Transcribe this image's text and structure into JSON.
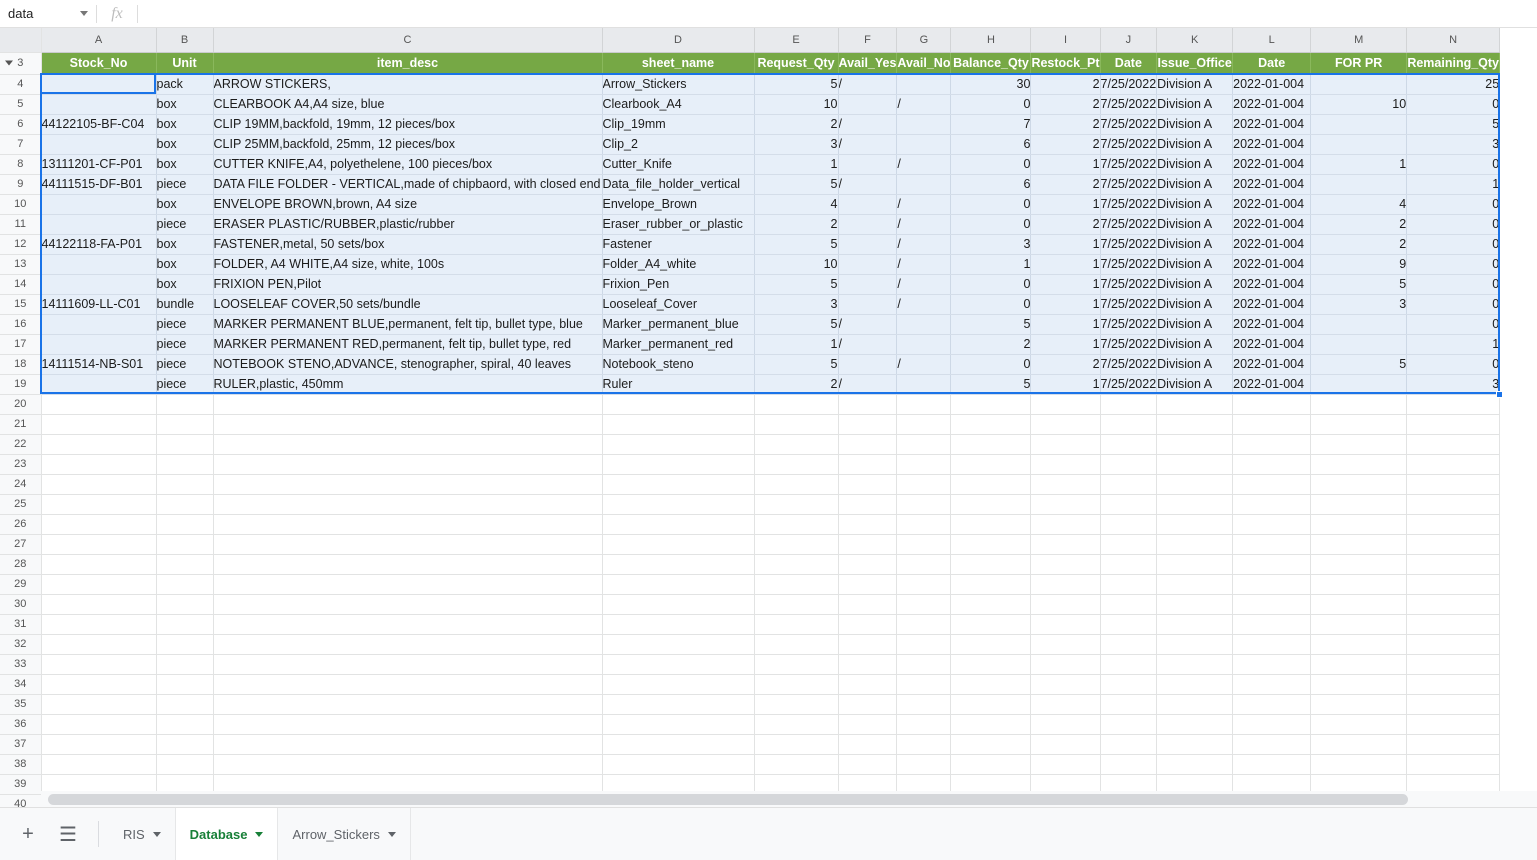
{
  "formula_bar": {
    "name_box_value": "data",
    "name_box_caret_icon": "chevron-down-icon",
    "fx_icon": "fx-icon",
    "formula_value": "",
    "formula_placeholder": ""
  },
  "grid": {
    "column_letters": [
      "A",
      "B",
      "C",
      "D",
      "E",
      "F",
      "G",
      "H",
      "I",
      "J",
      "K",
      "L",
      "M",
      "N"
    ],
    "header_row_number": "3",
    "headers": [
      "Stock_No",
      "Unit",
      "item_desc",
      "sheet_name",
      "Request_Qty",
      "Avail_Yes",
      "Avail_No",
      "Balance_Qty",
      "Restock_Pt",
      "Date",
      "Issue_Office",
      "Date",
      "FOR PR",
      "Remaining_Qty"
    ],
    "header_fill_color": "#76a845",
    "header_text_color": "#ffffff",
    "row_band_color": "#e7eff9",
    "selection_color": "#1a73e8",
    "data_row_numbers": [
      "4",
      "5",
      "6",
      "7",
      "8",
      "9",
      "10",
      "11",
      "12",
      "13",
      "14",
      "15",
      "16",
      "17",
      "18",
      "19"
    ],
    "empty_row_numbers": [
      "20",
      "21",
      "22",
      "23",
      "24",
      "25",
      "26",
      "27",
      "28",
      "29",
      "30",
      "31",
      "32",
      "33",
      "34",
      "35",
      "36",
      "37",
      "38",
      "39",
      "40"
    ],
    "rows": [
      {
        "n": "4",
        "stock_no": "",
        "unit": "pack",
        "item_desc": "ARROW STICKERS,",
        "sheet_name": "Arrow_Stickers",
        "request_qty": "5",
        "avail_yes": "/",
        "avail_no": "",
        "balance_qty": "30",
        "restock_pt": "2",
        "date": "7/25/2022",
        "issue_office": "Division A",
        "date2": "2022-01-004",
        "for_pr": "",
        "remaining_qty": "25"
      },
      {
        "n": "5",
        "stock_no": "",
        "unit": "box",
        "item_desc": "CLEARBOOK A4,A4 size, blue",
        "sheet_name": "Clearbook_A4",
        "request_qty": "10",
        "avail_yes": "",
        "avail_no": "/",
        "balance_qty": "0",
        "restock_pt": "2",
        "date": "7/25/2022",
        "issue_office": "Division A",
        "date2": "2022-01-004",
        "for_pr": "10",
        "remaining_qty": "0"
      },
      {
        "n": "6",
        "stock_no": "44122105-BF-C04",
        "unit": "box",
        "item_desc": "CLIP 19MM,backfold, 19mm, 12 pieces/box",
        "sheet_name": "Clip_19mm",
        "request_qty": "2",
        "avail_yes": "/",
        "avail_no": "",
        "balance_qty": "7",
        "restock_pt": "2",
        "date": "7/25/2022",
        "issue_office": "Division A",
        "date2": "2022-01-004",
        "for_pr": "",
        "remaining_qty": "5"
      },
      {
        "n": "7",
        "stock_no": "",
        "unit": "box",
        "item_desc": "CLIP 25MM,backfold, 25mm, 12 pieces/box",
        "sheet_name": "Clip_2",
        "request_qty": "3",
        "avail_yes": "/",
        "avail_no": "",
        "balance_qty": "6",
        "restock_pt": "2",
        "date": "7/25/2022",
        "issue_office": "Division A",
        "date2": "2022-01-004",
        "for_pr": "",
        "remaining_qty": "3"
      },
      {
        "n": "8",
        "stock_no": "13111201-CF-P01",
        "unit": "box",
        "item_desc": "CUTTER KNIFE,A4, polyethelene, 100 pieces/box",
        "sheet_name": "Cutter_Knife",
        "request_qty": "1",
        "avail_yes": "",
        "avail_no": "/",
        "balance_qty": "0",
        "restock_pt": "1",
        "date": "7/25/2022",
        "issue_office": "Division A",
        "date2": "2022-01-004",
        "for_pr": "1",
        "remaining_qty": "0"
      },
      {
        "n": "9",
        "stock_no": "44111515-DF-B01",
        "unit": "piece",
        "item_desc": "DATA FILE FOLDER - VERTICAL,made of chipbaord, with closed end",
        "sheet_name": "Data_file_holder_vertical",
        "request_qty": "5",
        "avail_yes": "/",
        "avail_no": "",
        "balance_qty": "6",
        "restock_pt": "2",
        "date": "7/25/2022",
        "issue_office": "Division A",
        "date2": "2022-01-004",
        "for_pr": "",
        "remaining_qty": "1"
      },
      {
        "n": "10",
        "stock_no": "",
        "unit": "box",
        "item_desc": "ENVELOPE BROWN,brown, A4 size",
        "sheet_name": "Envelope_Brown",
        "request_qty": "4",
        "avail_yes": "",
        "avail_no": "/",
        "balance_qty": "0",
        "restock_pt": "1",
        "date": "7/25/2022",
        "issue_office": "Division A",
        "date2": "2022-01-004",
        "for_pr": "4",
        "remaining_qty": "0"
      },
      {
        "n": "11",
        "stock_no": "",
        "unit": "piece",
        "item_desc": "ERASER PLASTIC/RUBBER,plastic/rubber",
        "sheet_name": "Eraser_rubber_or_plastic",
        "request_qty": "2",
        "avail_yes": "",
        "avail_no": "/",
        "balance_qty": "0",
        "restock_pt": "2",
        "date": "7/25/2022",
        "issue_office": "Division A",
        "date2": "2022-01-004",
        "for_pr": "2",
        "remaining_qty": "0"
      },
      {
        "n": "12",
        "stock_no": "44122118-FA-P01",
        "unit": "box",
        "item_desc": "FASTENER,metal, 50 sets/box",
        "sheet_name": "Fastener",
        "request_qty": "5",
        "avail_yes": "",
        "avail_no": "/",
        "balance_qty": "3",
        "restock_pt": "1",
        "date": "7/25/2022",
        "issue_office": "Division A",
        "date2": "2022-01-004",
        "for_pr": "2",
        "remaining_qty": "0"
      },
      {
        "n": "13",
        "stock_no": "",
        "unit": "box",
        "item_desc": "FOLDER, A4 WHITE,A4 size, white, 100s",
        "sheet_name": "Folder_A4_white",
        "request_qty": "10",
        "avail_yes": "",
        "avail_no": "/",
        "balance_qty": "1",
        "restock_pt": "1",
        "date": "7/25/2022",
        "issue_office": "Division A",
        "date2": "2022-01-004",
        "for_pr": "9",
        "remaining_qty": "0"
      },
      {
        "n": "14",
        "stock_no": "",
        "unit": "box",
        "item_desc": "FRIXION PEN,Pilot",
        "sheet_name": "Frixion_Pen",
        "request_qty": "5",
        "avail_yes": "",
        "avail_no": "/",
        "balance_qty": "0",
        "restock_pt": "1",
        "date": "7/25/2022",
        "issue_office": "Division A",
        "date2": "2022-01-004",
        "for_pr": "5",
        "remaining_qty": "0"
      },
      {
        "n": "15",
        "stock_no": "14111609-LL-C01",
        "unit": "bundle",
        "item_desc": "LOOSELEAF COVER,50 sets/bundle",
        "sheet_name": "Looseleaf_Cover",
        "request_qty": "3",
        "avail_yes": "",
        "avail_no": "/",
        "balance_qty": "0",
        "restock_pt": "1",
        "date": "7/25/2022",
        "issue_office": "Division A",
        "date2": "2022-01-004",
        "for_pr": "3",
        "remaining_qty": "0"
      },
      {
        "n": "16",
        "stock_no": "",
        "unit": "piece",
        "item_desc": "MARKER PERMANENT BLUE,permanent, felt tip, bullet type, blue",
        "sheet_name": "Marker_permanent_blue",
        "request_qty": "5",
        "avail_yes": "/",
        "avail_no": "",
        "balance_qty": "5",
        "restock_pt": "1",
        "date": "7/25/2022",
        "issue_office": "Division A",
        "date2": "2022-01-004",
        "for_pr": "",
        "remaining_qty": "0"
      },
      {
        "n": "17",
        "stock_no": "",
        "unit": "piece",
        "item_desc": "MARKER PERMANENT RED,permanent, felt tip, bullet type, red",
        "sheet_name": "Marker_permanent_red",
        "request_qty": "1",
        "avail_yes": "/",
        "avail_no": "",
        "balance_qty": "2",
        "restock_pt": "1",
        "date": "7/25/2022",
        "issue_office": "Division A",
        "date2": "2022-01-004",
        "for_pr": "",
        "remaining_qty": "1"
      },
      {
        "n": "18",
        "stock_no": "14111514-NB-S01",
        "unit": "piece",
        "item_desc": "NOTEBOOK STENO,ADVANCE, stenographer, spiral, 40 leaves",
        "sheet_name": "Notebook_steno",
        "request_qty": "5",
        "avail_yes": "",
        "avail_no": "/",
        "balance_qty": "0",
        "restock_pt": "2",
        "date": "7/25/2022",
        "issue_office": "Division A",
        "date2": "2022-01-004",
        "for_pr": "5",
        "remaining_qty": "0"
      },
      {
        "n": "19",
        "stock_no": "",
        "unit": "piece",
        "item_desc": "RULER,plastic, 450mm",
        "sheet_name": "Ruler",
        "request_qty": "2",
        "avail_yes": "/",
        "avail_no": "",
        "balance_qty": "5",
        "restock_pt": "1",
        "date": "7/25/2022",
        "issue_office": "Division A",
        "date2": "2022-01-004",
        "for_pr": "",
        "remaining_qty": "3"
      }
    ]
  },
  "tabbar": {
    "add_sheet_icon": "plus-icon",
    "all_sheets_icon": "list-menu-icon",
    "tabs": [
      {
        "label": "RIS",
        "active": false,
        "caret_icon": "chevron-down-icon"
      },
      {
        "label": "Database",
        "active": true,
        "caret_icon": "chevron-down-icon"
      },
      {
        "label": "Arrow_Stickers",
        "active": false,
        "caret_icon": "chevron-down-icon"
      }
    ]
  },
  "scrollbar": {
    "horizontal_scrollbar": "h-scrollbar"
  }
}
